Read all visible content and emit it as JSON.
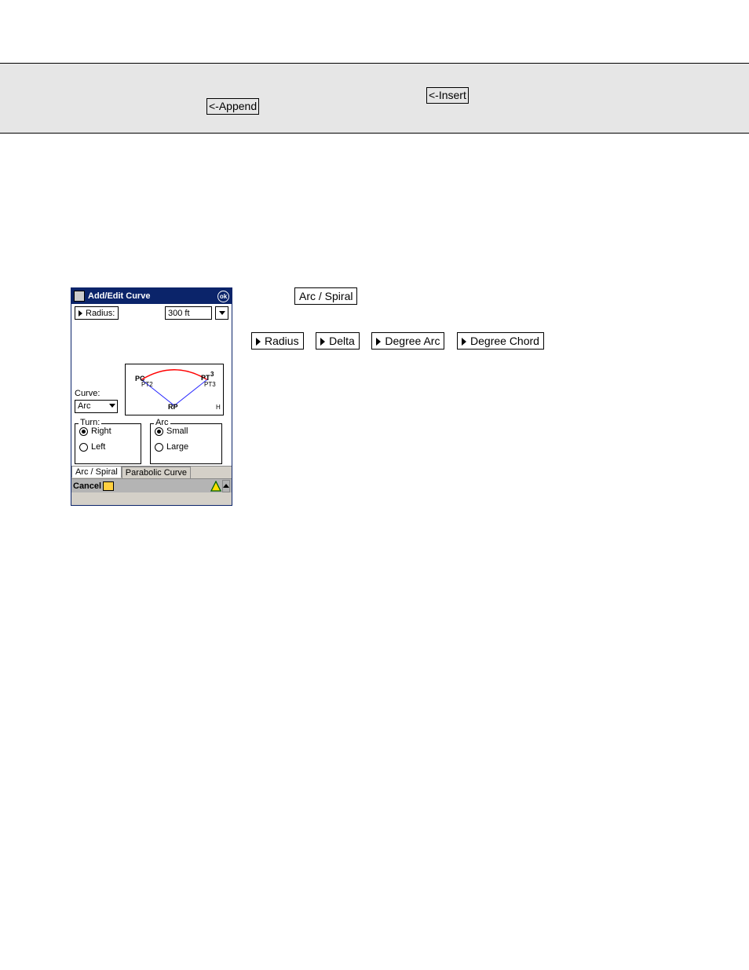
{
  "desc_band": {
    "append_label": "<-Append",
    "insert_label": "<-Insert"
  },
  "legend": {
    "arc_spiral": "Arc / Spiral",
    "row": {
      "radius": "Radius",
      "delta": "Delta",
      "degree_arc": "Degree Arc",
      "degree_chord": "Degree Chord"
    }
  },
  "dialog": {
    "title": "Add/Edit Curve",
    "ok_label": "ok",
    "radius_label": "Radius:",
    "radius_value": "300 ft",
    "curve_label": "Curve:",
    "curve_value": "Arc",
    "turn_group": {
      "legend": "Turn:",
      "right": "Right",
      "left": "Left"
    },
    "arc_group": {
      "legend": "Arc",
      "small": "Small",
      "large": "Large"
    },
    "tabs": {
      "arc_spiral": "Arc / Spiral",
      "parabolic": "Parabolic Curve"
    },
    "bottom": {
      "cancel": "Cancel"
    },
    "preview": {
      "pc": "PC",
      "pt": "PT",
      "pt2": "PT2",
      "pt3": "PT3",
      "three": "3",
      "rp": "RP",
      "h": "H"
    }
  }
}
